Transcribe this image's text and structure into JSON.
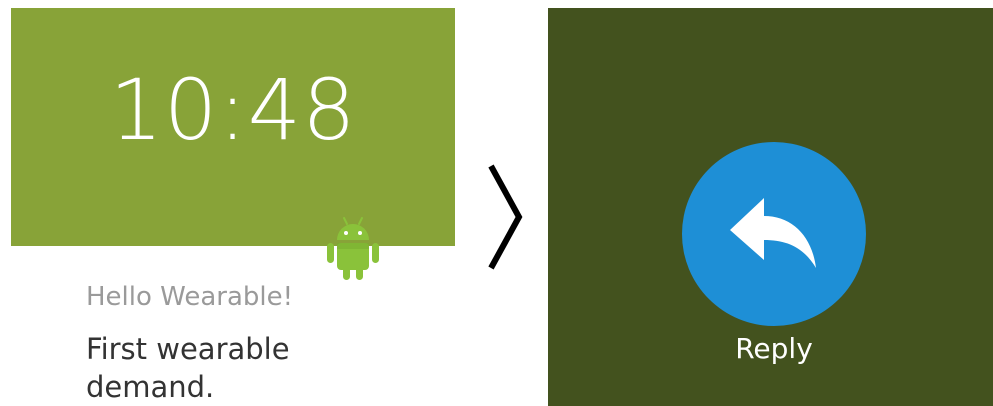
{
  "watch_face": {
    "time": "10:48",
    "background_color": "#88a338"
  },
  "notification": {
    "title": "Hello Wearable!",
    "text": "First wearable demand.",
    "app_icon": "android-robot-icon"
  },
  "navigation": {
    "next_icon": "chevron-right-icon"
  },
  "action_page": {
    "background_color": "#43521e",
    "button_color": "#1e8fd6",
    "icon": "reply-arrow-icon",
    "label": "Reply"
  }
}
